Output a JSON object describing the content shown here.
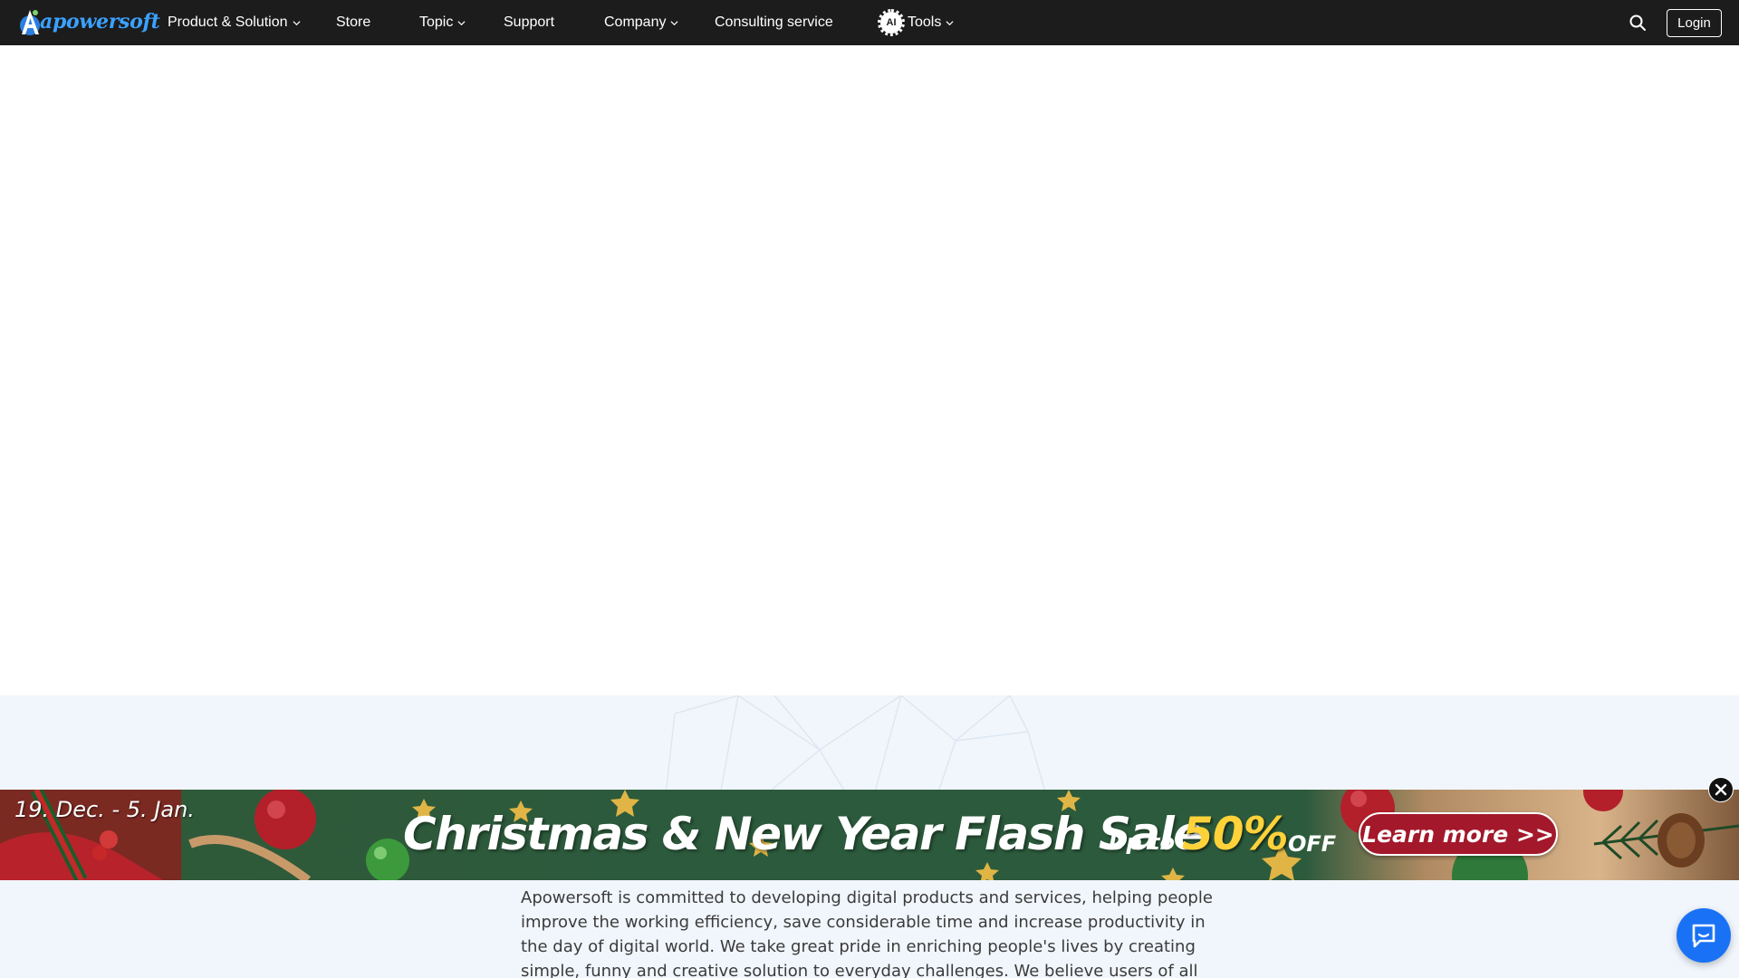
{
  "brand": {
    "name": "apowersoft",
    "logo_letter": "A",
    "color": "#3aa1ff"
  },
  "nav": {
    "items": [
      {
        "label": "Product & Solution",
        "has_dropdown": true
      },
      {
        "label": "Store",
        "has_dropdown": false
      },
      {
        "label": "Topic",
        "has_dropdown": true
      },
      {
        "label": "Support",
        "has_dropdown": false
      },
      {
        "label": "Company",
        "has_dropdown": true
      },
      {
        "label": "Consulting service",
        "has_dropdown": false
      },
      {
        "label": "Tools",
        "has_dropdown": true,
        "badge": "AI"
      }
    ],
    "search_icon": "search-icon",
    "login_label": "Login"
  },
  "about": {
    "text": "Apowersoft is committed to developing digital products and services, helping people improve the working efficiency, save considerable time and increase productivity in the day of digital world. We take great pride in enriching people's lives by creating simple, funny and creative solution to everyday challenges. We believe users of all levels will be amazed"
  },
  "promo": {
    "dates": "19. Dec. - 5. Jan.",
    "title": "Christmas & New Year Flash Sale",
    "up_to": "Up to",
    "percent": "50%",
    "off": "OFF",
    "cta": "Learn more >>",
    "close_icon": "close-icon",
    "colors": {
      "background": "#2c5a3c",
      "cta": "#a3182a",
      "accent": "#ffd23a"
    }
  },
  "chat": {
    "icon": "chat-bubble-icon",
    "color": "#1972f5"
  }
}
